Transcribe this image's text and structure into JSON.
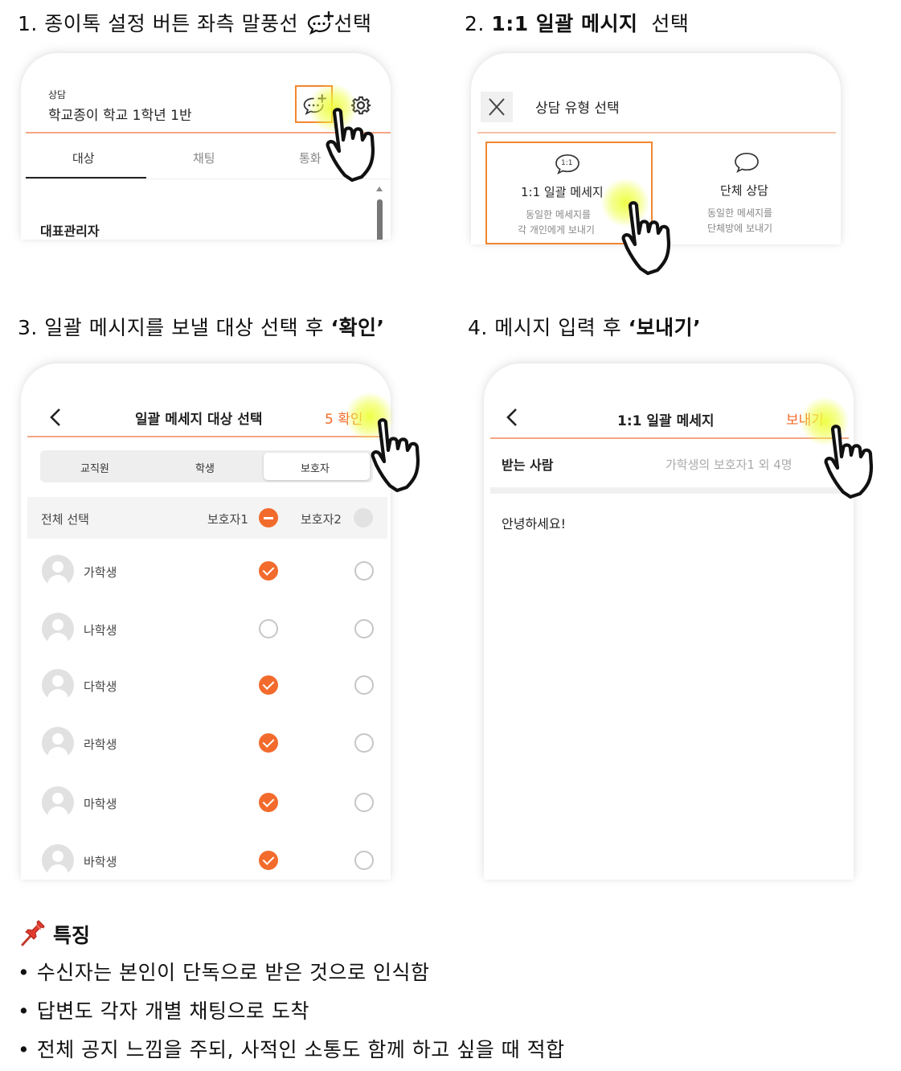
{
  "steps": {
    "s1": "1. 종이톡 설정 버튼 좌측 말풍선",
    "s1_suffix": "선택",
    "s2_prefix": "2.",
    "s2_bold": "1:1 일괄 메시지",
    "s2_suffix": "선택",
    "s3_prefix": "3. 일괄 메시지를 보낼 대상 선택 후",
    "s3_bold": "‘확인’",
    "s4_prefix": "4. 메시지 입력 후",
    "s4_bold": "‘보내기’"
  },
  "screen1": {
    "category": "상담",
    "room_name": "학교종이 학교 1학년 1반",
    "tabs": [
      "대상",
      "채팅",
      "통화"
    ],
    "section": "대표관리자"
  },
  "screen2": {
    "title": "상담 유형 선택",
    "options": [
      {
        "title": "1:1 일괄 메세지",
        "icon_label": "1:1",
        "desc1": "동일한 메세지를",
        "desc2": "각 개인에게 보내기"
      },
      {
        "title": "단체 상담",
        "desc1": "동일한 메세지를",
        "desc2": "단체방에 보내기"
      }
    ]
  },
  "screen3": {
    "title": "일괄 메세지 대상 선택",
    "confirm": "5 확인",
    "segments": [
      "교직원",
      "학생",
      "보호자"
    ],
    "select_all": "전체 선택",
    "col1": "보호자1",
    "col2": "보호자2",
    "students": [
      {
        "name": "가학생",
        "p1": true,
        "p2": false
      },
      {
        "name": "나학생",
        "p1": false,
        "p2": false
      },
      {
        "name": "다학생",
        "p1": true,
        "p2": false
      },
      {
        "name": "라학생",
        "p1": true,
        "p2": false
      },
      {
        "name": "마학생",
        "p1": true,
        "p2": false
      },
      {
        "name": "바학생",
        "p1": true,
        "p2": false
      }
    ]
  },
  "screen4": {
    "title": "1:1 일괄 메세지",
    "send": "보내기",
    "recipient_label": "받는 사람",
    "recipient_value": "가학생의 보호자1 외 4명",
    "message": "안녕하세요!"
  },
  "features": {
    "heading": "특징",
    "items": [
      "수신자는 본인이 단독으로 받은 것으로 인식함",
      "답변도 각자 개별 채팅으로 도착",
      "전체 공지 느낌을 주되, 사적인 소통도 함께 하고 싶을 때 적합"
    ]
  },
  "colors": {
    "accent": "#f26b2c",
    "highlight": "#eeff3c"
  },
  "icons": [
    "chat-plus-icon",
    "gear-icon",
    "close-icon",
    "chat-icon",
    "back-icon",
    "chevron-right-icon",
    "pin-icon",
    "pointing-hand-icon"
  ]
}
